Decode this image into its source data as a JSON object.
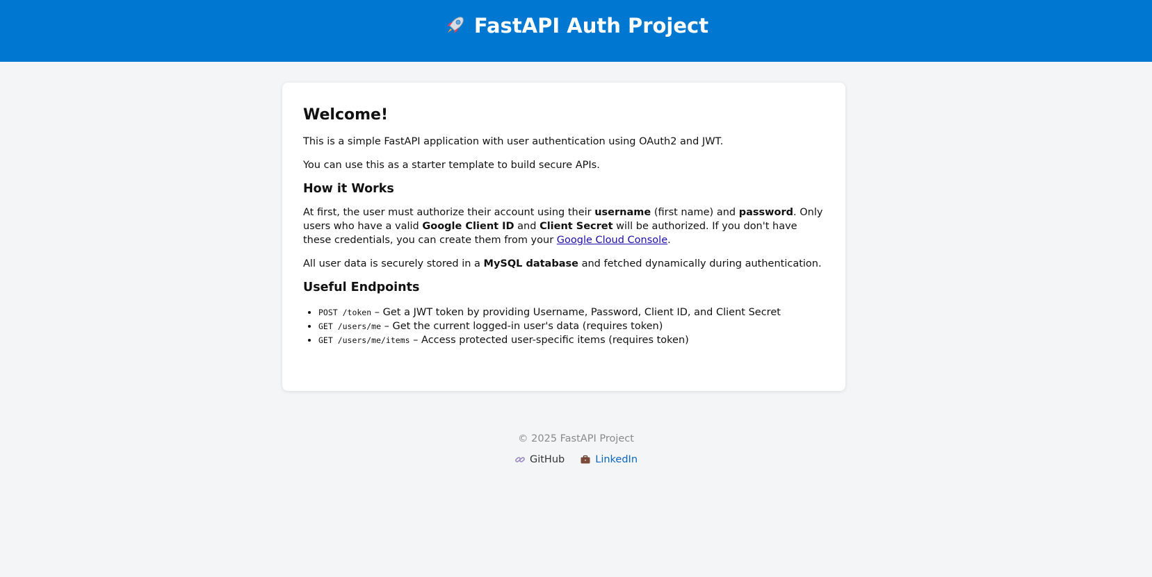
{
  "header": {
    "title": "FastAPI Auth Project",
    "icon": "rocket-icon"
  },
  "card": {
    "welcome": "Welcome!",
    "intro1": "This is a simple FastAPI application with user authentication using OAuth2 and JWT.",
    "intro2": "You can use this as a starter template to build secure APIs.",
    "how_heading": "How it Works",
    "how_p1": {
      "t1": "At first, the user must authorize their account using their ",
      "b1": "username",
      "t2": " (first name) and ",
      "b2": "password",
      "t3": ". Only users who have a valid ",
      "b3": "Google Client ID",
      "t4": " and ",
      "b4": "Client Secret",
      "t5": " will be authorized. If you don't have these credentials, you can create them from your ",
      "link": "Google Cloud Console",
      "t6": "."
    },
    "how_p2": {
      "t1": "All user data is securely stored in a ",
      "b1": "MySQL database",
      "t2": " and fetched dynamically during authentication."
    },
    "endpoints_heading": "Useful Endpoints",
    "endpoints": [
      {
        "code": "POST /token",
        "desc": " – Get a JWT token by providing Username, Password, Client ID, and Client Secret"
      },
      {
        "code": "GET /users/me",
        "desc": " – Get the current logged-in user's data (requires token)"
      },
      {
        "code": "GET /users/me/items",
        "desc": " – Access protected user-specific items (requires token)"
      }
    ]
  },
  "footer": {
    "copyright": "© 2025 FastAPI Project",
    "github": {
      "label": "GitHub",
      "icon": "link-icon"
    },
    "linkedin": {
      "label": "LinkedIn",
      "icon": "briefcase-icon"
    }
  }
}
